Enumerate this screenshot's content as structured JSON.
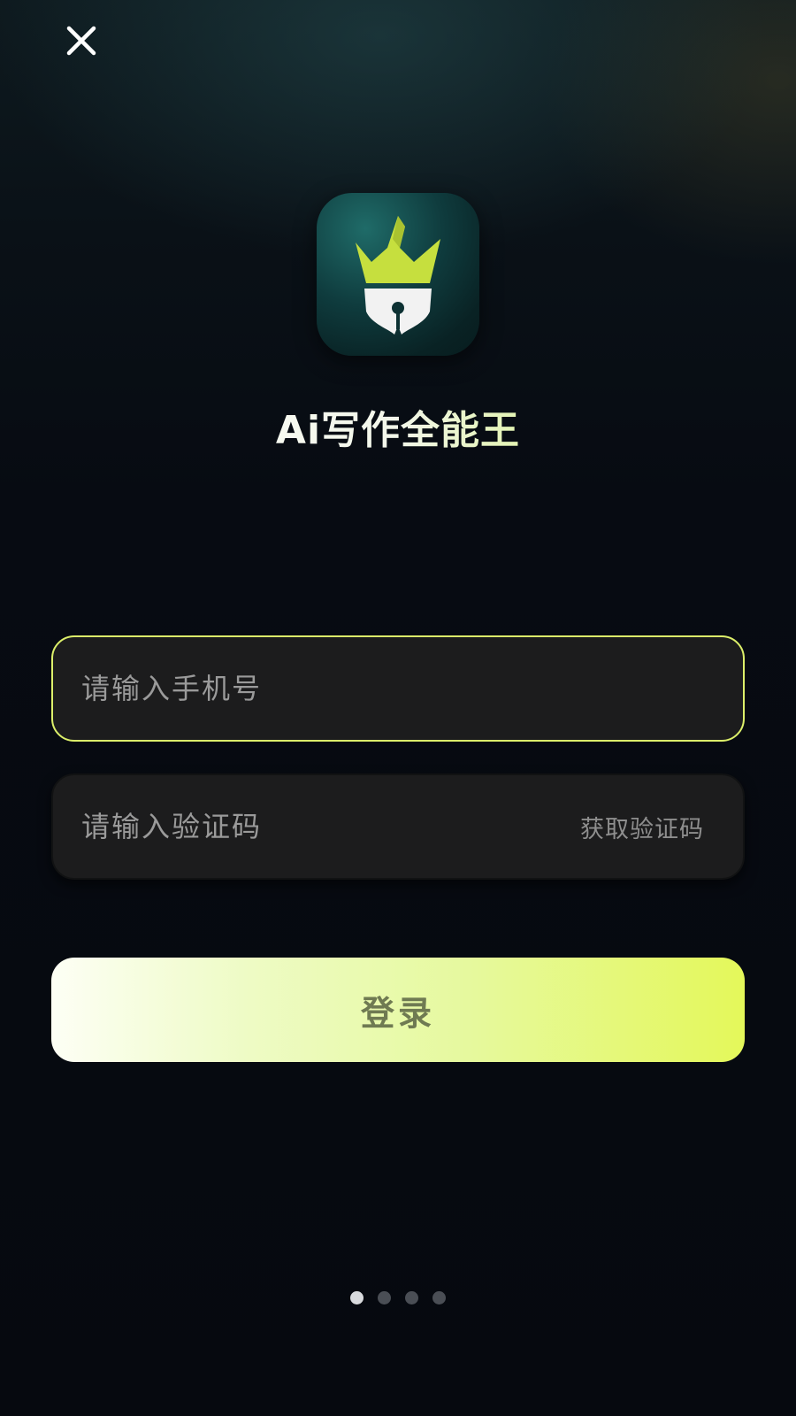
{
  "app": {
    "name": "Ai写作全能王",
    "logo_icon": "crown-pen-nib-icon"
  },
  "header": {
    "close_icon": "close-icon"
  },
  "form": {
    "phone_placeholder": "请输入手机号",
    "phone_value": "",
    "code_placeholder": "请输入验证码",
    "code_value": "",
    "get_code_label": "获取验证码",
    "login_label": "登录"
  },
  "pagination": {
    "total": 4,
    "current": 1
  },
  "colors": {
    "accent": "#dcef6a",
    "background": "#070b12",
    "field_background": "#1c1c1d",
    "login_gradient_start": "#fdfff5",
    "login_gradient_end": "#e4f85a"
  }
}
